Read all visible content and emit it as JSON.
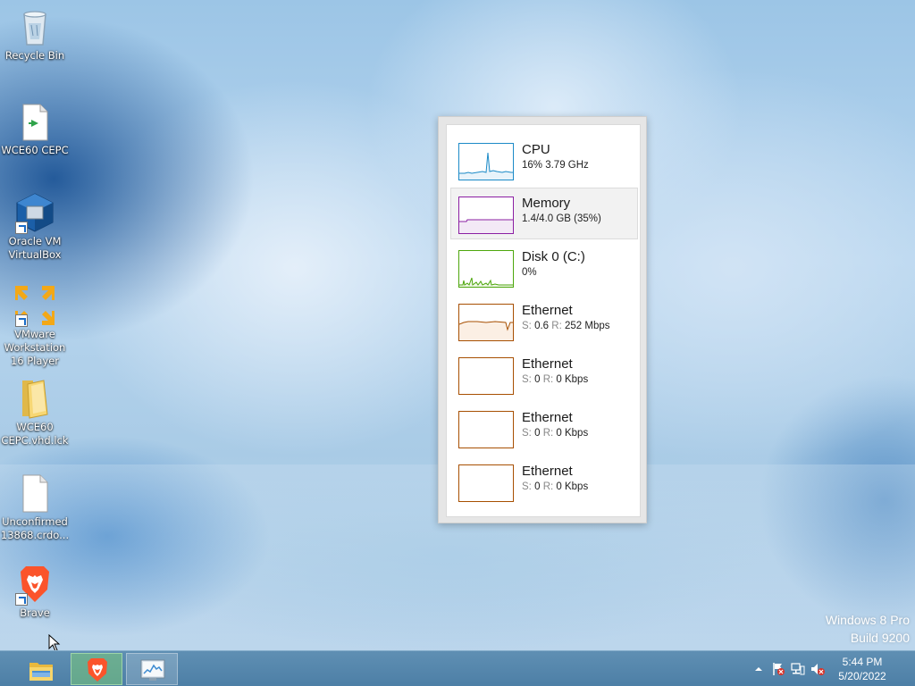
{
  "desktop": {
    "icons": [
      {
        "label": "Recycle Bin",
        "icon": "recycle-bin-icon"
      },
      {
        "label": "WCE60 CEPC",
        "icon": "file-icon"
      },
      {
        "label": "Oracle VM VirtualBox",
        "icon": "virtualbox-icon"
      },
      {
        "label": "VMware Workstation 16 Player",
        "icon": "vmware-icon"
      },
      {
        "label": "WCE60 CEPC.vhd.lck",
        "icon": "folder-icon"
      },
      {
        "label": "Unconfirmed 13868.crdo...",
        "icon": "blank-file-icon"
      },
      {
        "label": "Brave",
        "icon": "brave-icon"
      }
    ]
  },
  "performance": {
    "items": [
      {
        "title": "CPU",
        "subtitle": "16%  3.79 GHz",
        "color": "#1b8ac7",
        "fill": "#e8f3fa",
        "selected": false
      },
      {
        "title": "Memory",
        "subtitle": "1.4/4.0 GB (35%)",
        "color": "#8b1fa3",
        "fill": "#f3e9f6",
        "selected": true
      },
      {
        "title": "Disk 0 (C:)",
        "subtitle": "0%",
        "color": "#4da60c",
        "fill": "#eef7e6",
        "selected": false
      },
      {
        "title": "Ethernet",
        "send_label": "S:",
        "send": "0.6",
        "recv_label": "R:",
        "recv": "252 Mbps",
        "color": "#a74f01",
        "fill": "#fbefe4",
        "selected": false
      },
      {
        "title": "Ethernet",
        "send_label": "S:",
        "send": "0",
        "recv_label": "R:",
        "recv": "0 Kbps",
        "color": "#a74f01",
        "fill": "#ffffff",
        "selected": false
      },
      {
        "title": "Ethernet",
        "send_label": "S:",
        "send": "0",
        "recv_label": "R:",
        "recv": "0 Kbps",
        "color": "#a74f01",
        "fill": "#ffffff",
        "selected": false
      },
      {
        "title": "Ethernet",
        "send_label": "S:",
        "send": "0",
        "recv_label": "R:",
        "recv": "0 Kbps",
        "color": "#a74f01",
        "fill": "#ffffff",
        "selected": false
      }
    ]
  },
  "watermark": {
    "line1": "Windows 8 Pro",
    "line2": "Build 9200"
  },
  "taskbar": {
    "buttons": [
      {
        "name": "file-explorer",
        "icon": "folder-icon",
        "state": "normal"
      },
      {
        "name": "brave",
        "icon": "brave-icon",
        "state": "active"
      },
      {
        "name": "task-manager",
        "icon": "task-manager-icon",
        "state": "open"
      }
    ],
    "tray": {
      "icons": [
        "show-hidden-icons-chevron-icon",
        "action-center-flag-icon",
        "network-icon",
        "volume-muted-icon"
      ]
    },
    "clock": {
      "time": "5:44 PM",
      "date": "5/20/2022"
    }
  }
}
